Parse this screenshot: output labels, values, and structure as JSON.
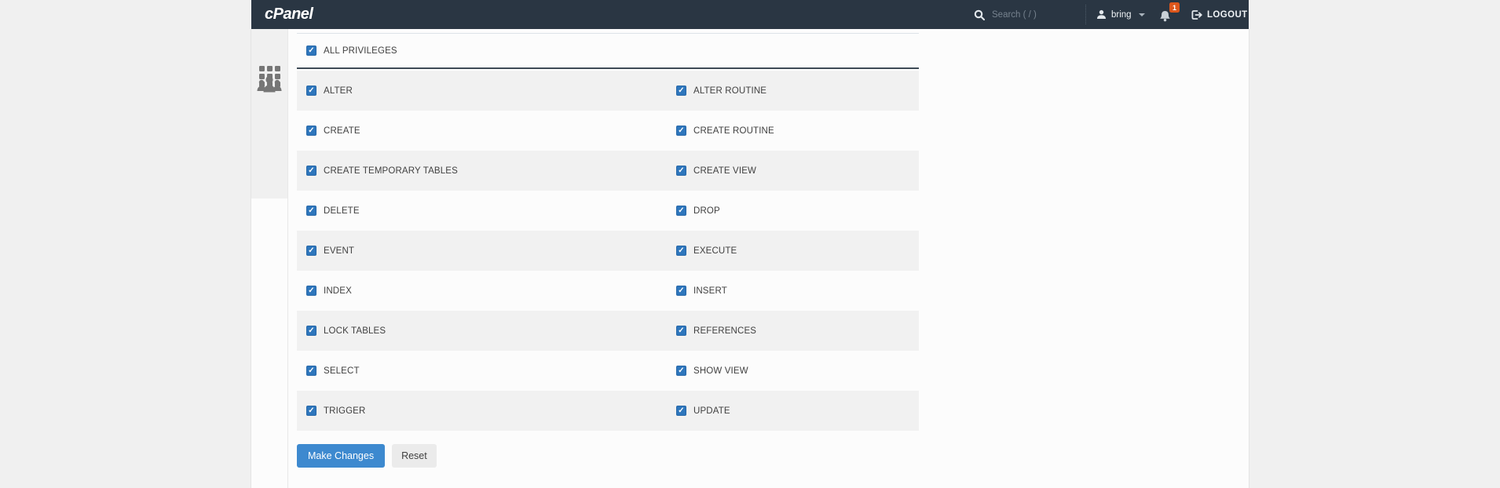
{
  "header": {
    "logo_text": "cPanel",
    "search_label": "Search ( / )",
    "user_name": "bring",
    "notification_count": "1",
    "logout_label": "LOGOUT"
  },
  "sidebar": {
    "items": [
      {
        "icon": "apps-grid-3x3"
      },
      {
        "icon": "user-group"
      }
    ]
  },
  "privileges": {
    "all": {
      "label": "ALL PRIVILEGES",
      "checked": true
    },
    "rows": [
      {
        "left": "ALTER",
        "right": "ALTER ROUTINE",
        "left_checked": true,
        "right_checked": true
      },
      {
        "left": "CREATE",
        "right": "CREATE ROUTINE",
        "left_checked": true,
        "right_checked": true
      },
      {
        "left": "CREATE TEMPORARY TABLES",
        "right": "CREATE VIEW",
        "left_checked": true,
        "right_checked": true
      },
      {
        "left": "DELETE",
        "right": "DROP",
        "left_checked": true,
        "right_checked": true
      },
      {
        "left": "EVENT",
        "right": "EXECUTE",
        "left_checked": true,
        "right_checked": true
      },
      {
        "left": "INDEX",
        "right": "INSERT",
        "left_checked": true,
        "right_checked": true
      },
      {
        "left": "LOCK TABLES",
        "right": "REFERENCES",
        "left_checked": true,
        "right_checked": true
      },
      {
        "left": "SELECT",
        "right": "SHOW VIEW",
        "left_checked": true,
        "right_checked": true
      },
      {
        "left": "TRIGGER",
        "right": "UPDATE",
        "left_checked": true,
        "right_checked": true
      }
    ],
    "make_changes_label": "Make Changes",
    "reset_label": "Reset"
  },
  "icons": {
    "search": "magnifier",
    "user": "person-silhouette",
    "notifications": "bell",
    "logout": "exit-arrow",
    "checkbox": "checkmark"
  },
  "colors": {
    "page_bg": "#f0f0f0",
    "content_bg": "#fcfcfc",
    "header_bg": "#2a3643",
    "row_stripe": "#f1f1f1",
    "separator_dark": "#3e4a56",
    "checkbox_blue": "#2e76bc",
    "button_blue": "#3d89cf",
    "badge_orange": "#dd571c"
  }
}
